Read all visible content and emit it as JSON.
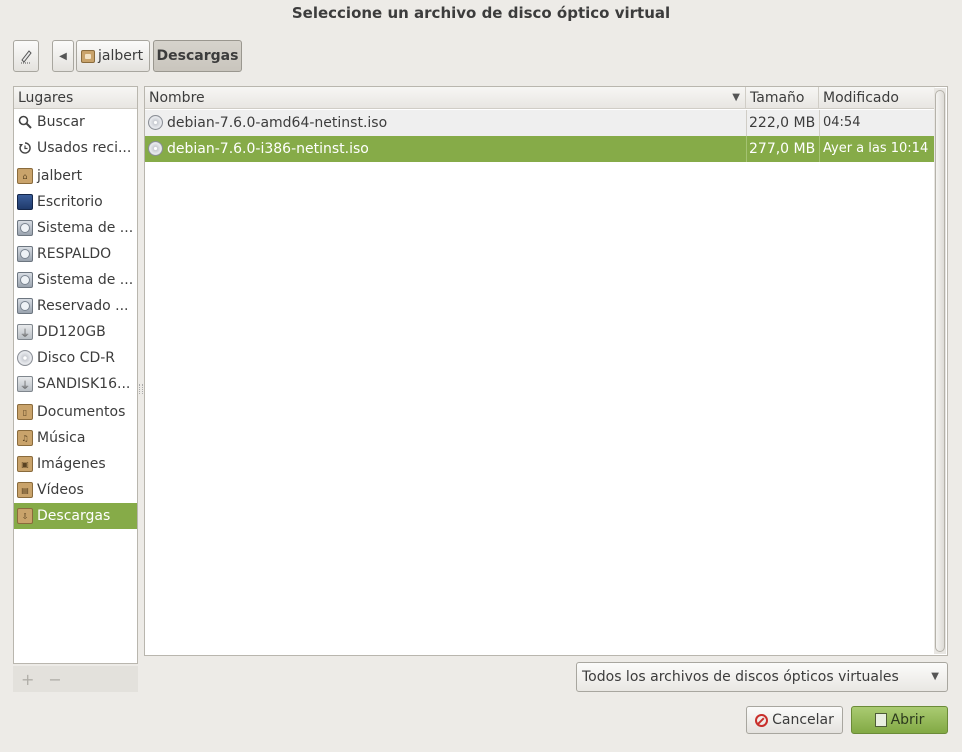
{
  "window": {
    "title": "Seleccione un archivo de disco óptico virtual"
  },
  "pathbar": {
    "back_symbol": "◀",
    "crumbs": [
      {
        "label": "jalbert",
        "icon": "home-folder-icon"
      },
      {
        "label": "Descargas",
        "active": true
      }
    ]
  },
  "sidebar": {
    "header": "Lugares",
    "items": [
      {
        "label": "Buscar",
        "icon": "search-icon"
      },
      {
        "label": "Usados reci...",
        "icon": "recent-icon"
      },
      {
        "label": "jalbert",
        "icon": "home-folder-icon"
      },
      {
        "label": "Escritorio",
        "icon": "desktop-icon"
      },
      {
        "label": "Sistema de ...",
        "icon": "drive-icon"
      },
      {
        "label": "RESPALDO",
        "icon": "drive-icon"
      },
      {
        "label": "Sistema de ...",
        "icon": "drive-icon"
      },
      {
        "label": "Reservado ...",
        "icon": "drive-icon"
      },
      {
        "label": "DD120GB",
        "icon": "usb-drive-icon"
      },
      {
        "label": "Disco CD-R",
        "icon": "cd-icon"
      },
      {
        "label": "SANDISK16...",
        "icon": "usb-drive-icon"
      },
      {
        "label": "Documentos",
        "icon": "documents-folder-icon"
      },
      {
        "label": "Música",
        "icon": "music-folder-icon"
      },
      {
        "label": "Imágenes",
        "icon": "pictures-folder-icon"
      },
      {
        "label": "Vídeos",
        "icon": "videos-folder-icon"
      },
      {
        "label": "Descargas",
        "icon": "downloads-folder-icon",
        "selected": true
      }
    ],
    "add_symbol": "+",
    "remove_symbol": "−"
  },
  "filelist": {
    "columns": {
      "name": "Nombre",
      "size": "Tamaño",
      "modified": "Modificado"
    },
    "rows": [
      {
        "name": "debian-7.6.0-amd64-netinst.iso",
        "size": "222,0 MB",
        "modified": "04:54"
      },
      {
        "name": "debian-7.6.0-i386-netinst.iso",
        "size": "277,0 MB",
        "modified": "Ayer a las 10:14",
        "selected": true
      }
    ]
  },
  "filter": {
    "selected": "Todos los archivos de discos ópticos virtuales"
  },
  "actions": {
    "cancel_label": "Cancelar",
    "open_label": "Abrir"
  },
  "colors": {
    "selection": "#86ab48",
    "background": "#edebe7",
    "cancel_icon": "#c9302c"
  }
}
